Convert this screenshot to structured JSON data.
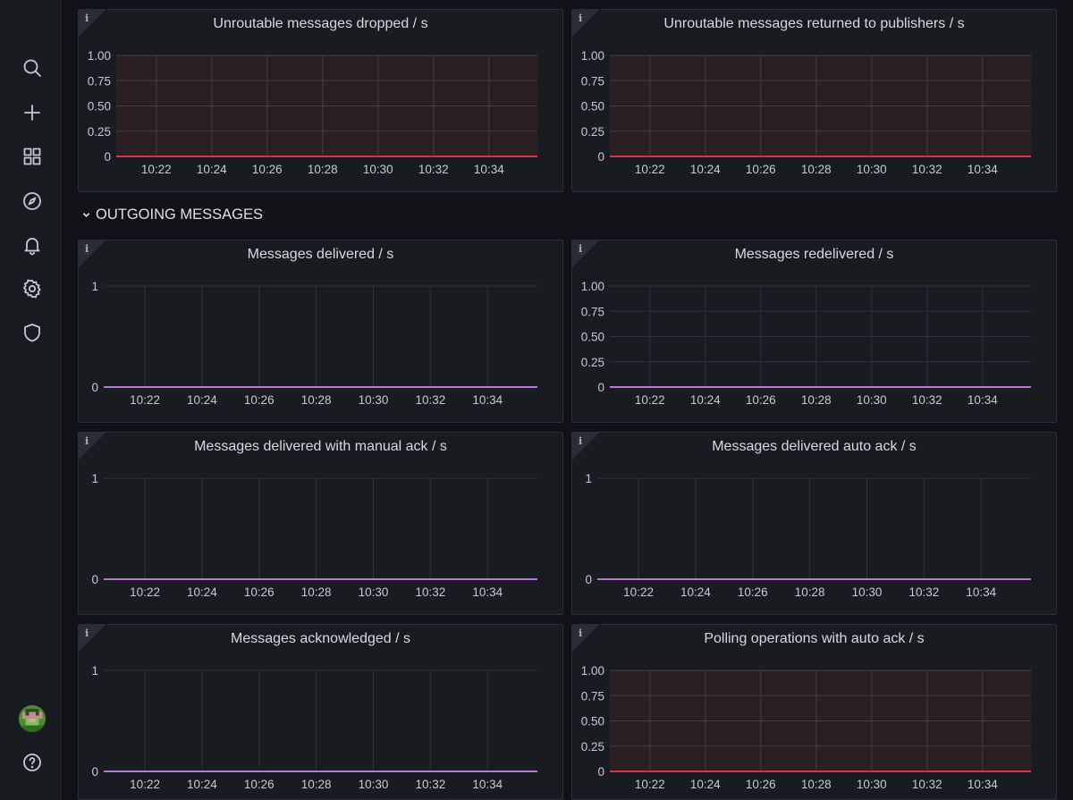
{
  "section_header": {
    "label": "OUTGOING MESSAGES"
  },
  "nav": [
    "search-icon",
    "plus-icon",
    "dashboards-icon",
    "explore-icon",
    "alerting-icon",
    "settings-icon",
    "shield-icon",
    "help-icon"
  ],
  "colors": {
    "red_series": "#e02f44",
    "purple_series": "#b877d9",
    "threshold_fill": "#2a1f22"
  },
  "panels": [
    {
      "id": "p1",
      "title": "Unroutable messages dropped / s",
      "series_color": "#e02f44",
      "threshold_fill": true,
      "y_ticks": [
        "1.00",
        "0.75",
        "0.50",
        "0.25",
        "0"
      ],
      "x_ticks": [
        "10:22",
        "10:24",
        "10:26",
        "10:28",
        "10:30",
        "10:32",
        "10:34"
      ]
    },
    {
      "id": "p2",
      "title": "Unroutable messages returned to publishers / s",
      "series_color": "#e02f44",
      "threshold_fill": true,
      "y_ticks": [
        "1.00",
        "0.75",
        "0.50",
        "0.25",
        "0"
      ],
      "x_ticks": [
        "10:22",
        "10:24",
        "10:26",
        "10:28",
        "10:30",
        "10:32",
        "10:34"
      ]
    },
    {
      "id": "p3",
      "title": "Messages delivered / s",
      "series_color": "#b877d9",
      "threshold_fill": false,
      "y_ticks": [
        "1",
        "0"
      ],
      "x_ticks": [
        "10:22",
        "10:24",
        "10:26",
        "10:28",
        "10:30",
        "10:32",
        "10:34"
      ]
    },
    {
      "id": "p4",
      "title": "Messages redelivered / s",
      "series_color": "#b877d9",
      "threshold_fill": false,
      "y_ticks": [
        "1.00",
        "0.75",
        "0.50",
        "0.25",
        "0"
      ],
      "x_ticks": [
        "10:22",
        "10:24",
        "10:26",
        "10:28",
        "10:30",
        "10:32",
        "10:34"
      ]
    },
    {
      "id": "p5",
      "title": "Messages delivered with manual ack / s",
      "series_color": "#b877d9",
      "threshold_fill": false,
      "y_ticks": [
        "1",
        "0"
      ],
      "x_ticks": [
        "10:22",
        "10:24",
        "10:26",
        "10:28",
        "10:30",
        "10:32",
        "10:34"
      ]
    },
    {
      "id": "p6",
      "title": "Messages delivered auto ack / s",
      "series_color": "#b877d9",
      "threshold_fill": false,
      "y_ticks": [
        "1",
        "0"
      ],
      "x_ticks": [
        "10:22",
        "10:24",
        "10:26",
        "10:28",
        "10:30",
        "10:32",
        "10:34"
      ]
    },
    {
      "id": "p7",
      "title": "Messages acknowledged / s",
      "series_color": "#b877d9",
      "threshold_fill": false,
      "y_ticks": [
        "1",
        "0"
      ],
      "x_ticks": [
        "10:22",
        "10:24",
        "10:26",
        "10:28",
        "10:30",
        "10:32",
        "10:34"
      ]
    },
    {
      "id": "p8",
      "title": "Polling operations with auto ack / s",
      "series_color": "#e02f44",
      "threshold_fill": true,
      "y_ticks": [
        "1.00",
        "0.75",
        "0.50",
        "0.25",
        "0"
      ],
      "x_ticks": [
        "10:22",
        "10:24",
        "10:26",
        "10:28",
        "10:30",
        "10:32",
        "10:34"
      ]
    }
  ]
}
